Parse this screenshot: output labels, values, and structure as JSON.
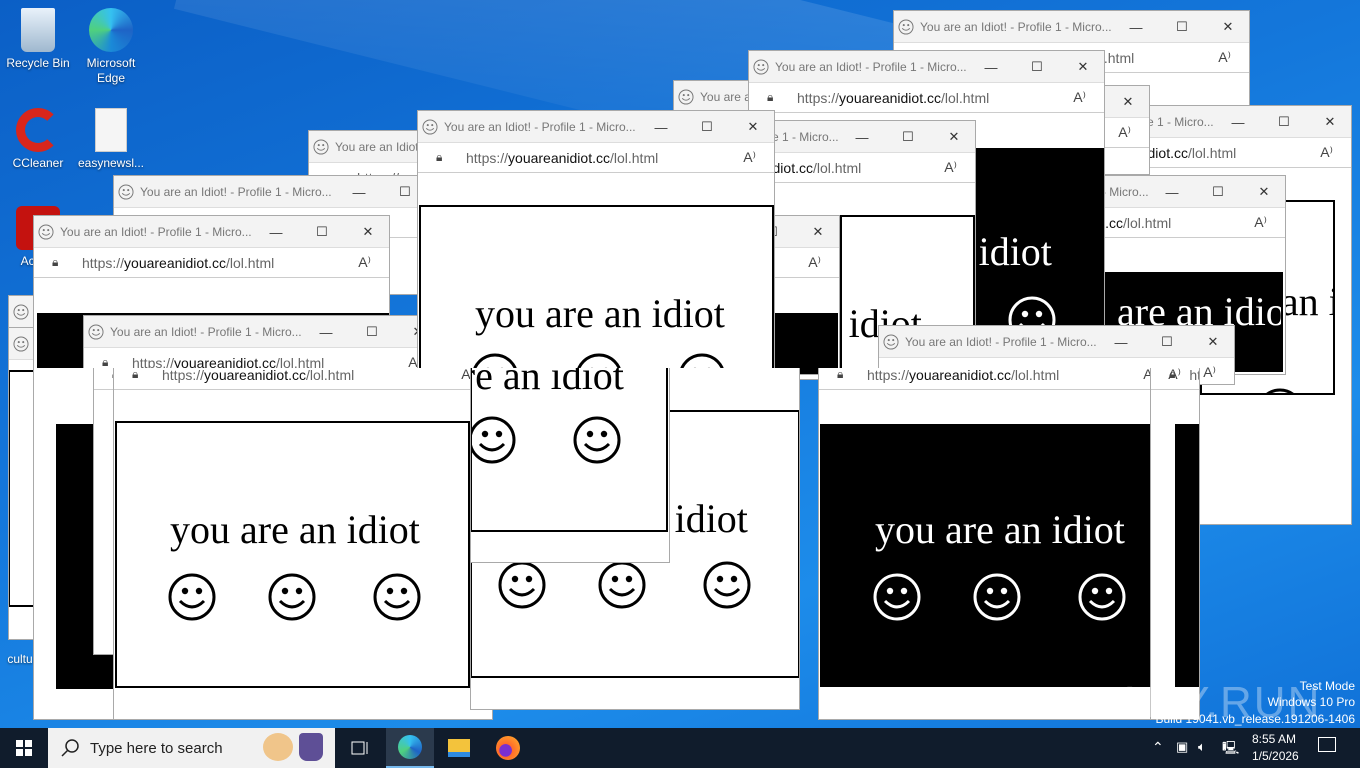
{
  "desktop": {
    "icons": [
      {
        "label": "Recycle Bin"
      },
      {
        "label": "Microsoft Edge"
      },
      {
        "label": "CCleaner"
      },
      {
        "label": "easynewsl..."
      },
      {
        "label": "Ac Acr"
      },
      {
        "label": "cultu"
      }
    ]
  },
  "browser": {
    "title": "You are an Idiot! - Profile 1 - Micro...",
    "url_prefix": "https://",
    "url_domain": "youareanidiot.cc",
    "url_path": "/lol.html",
    "minimize": "—",
    "maximize": "☐",
    "close": "✕",
    "read_aloud": "A⁾",
    "lock": "🔒"
  },
  "content": {
    "text": "you are an idiot"
  },
  "taskbar": {
    "search_placeholder": "Type here to search",
    "time": "8:55 AM",
    "date": "1/5/2026"
  },
  "watermark": {
    "brand": "ANY.RUN",
    "line1": "Test Mode",
    "line2": "Windows 10 Pro",
    "line3": "Build 19041.vb_release.191206-1406"
  },
  "colors": {
    "accent": "#0078d7",
    "taskbar": "#101c2c"
  }
}
